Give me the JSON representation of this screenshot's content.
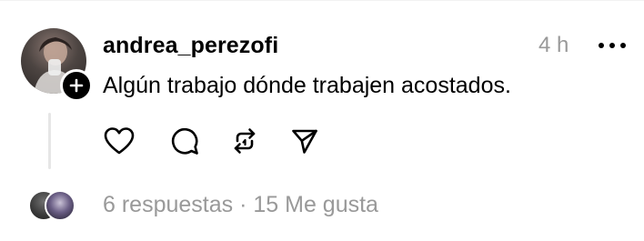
{
  "post": {
    "username": "andrea_perezofi",
    "timestamp": "4 h",
    "text": "Algún trabajo dónde trabajen acostados.",
    "replies_label": "6 respuestas",
    "separator": "·",
    "likes_label": "15 Me gusta"
  },
  "icons": {
    "more": "more-horizontal-icon",
    "follow": "plus-icon",
    "like": "heart-icon",
    "comment": "comment-icon",
    "repost": "repost-icon",
    "share": "send-icon"
  },
  "colors": {
    "text_primary": "#000000",
    "text_secondary": "#999999",
    "thread_line": "#e6e6e6"
  }
}
